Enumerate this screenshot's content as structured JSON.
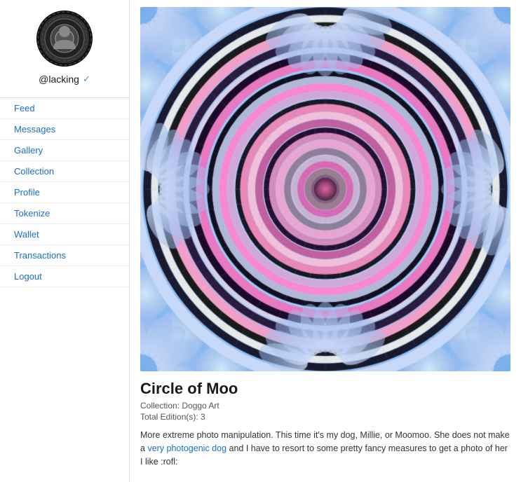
{
  "sidebar": {
    "username": "@lacking",
    "nav_items": [
      {
        "label": "Feed",
        "href": "#"
      },
      {
        "label": "Messages",
        "href": "#"
      },
      {
        "label": "Gallery",
        "href": "#"
      },
      {
        "label": "Collection",
        "href": "#"
      },
      {
        "label": "Profile",
        "href": "#"
      },
      {
        "label": "Tokenize",
        "href": "#"
      },
      {
        "label": "Wallet",
        "href": "#"
      },
      {
        "label": "Transactions",
        "href": "#"
      },
      {
        "label": "Logout",
        "href": "#"
      }
    ]
  },
  "artwork": {
    "title": "Circle of Moo",
    "collection_label": "Collection: Doggo Art",
    "editions_label": "Total Edition(s): 3",
    "description": "More extreme photo manipulation. This time it's my dog, Millie, or Moomoo. She does not make a very photogenic dog and I have to resort to some pretty fancy measures to get a photo of her I like :rofl:"
  },
  "icons": {
    "verified": "✓"
  }
}
